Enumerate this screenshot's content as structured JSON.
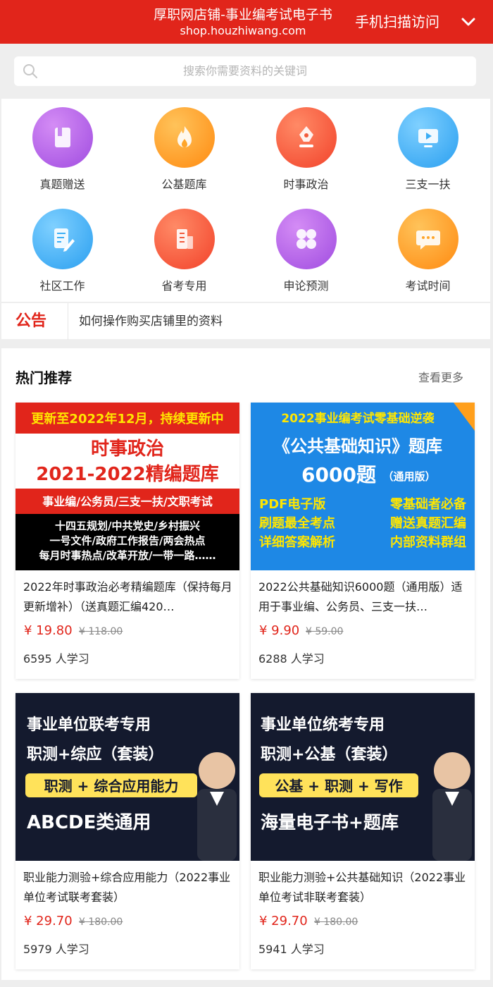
{
  "header": {
    "title": "厚职网店铺-事业编考试电子书",
    "url": "shop.houzhiwang.com",
    "scan_label": "手机扫描访问",
    "chevron_icon": "chevron-down-icon",
    "background": "#e1251b"
  },
  "search": {
    "placeholder": "搜索你需要资料的关键词",
    "icon": "search-icon"
  },
  "categories": [
    {
      "label": "真题赠送",
      "icon": "book-icon",
      "color": "#b15fe6"
    },
    {
      "label": "公基题库",
      "icon": "flame-icon",
      "color": "#ff9f1c"
    },
    {
      "label": "时事政治",
      "icon": "pen-nib-icon",
      "color": "#ff5a3c"
    },
    {
      "label": "三支一扶",
      "icon": "video-icon",
      "color": "#3aaef5"
    },
    {
      "label": "社区工作",
      "icon": "document-edit-icon",
      "color": "#3aaef5"
    },
    {
      "label": "省考专用",
      "icon": "building-icon",
      "color": "#ff5a3c"
    },
    {
      "label": "申论预测",
      "icon": "clover-icon",
      "color": "#b15fe6"
    },
    {
      "label": "考试时间",
      "icon": "chat-bubble-icon",
      "color": "#ff9f1c"
    }
  ],
  "notice": {
    "tag": "公告",
    "text": "如何操作购买店铺里的资料"
  },
  "hot": {
    "title": "热门推荐",
    "more": "查看更多"
  },
  "products": [
    {
      "name": "2022年时事政治必考精编题库（保持每月更新增补）（送真题汇编420…",
      "price": "¥ 19.80",
      "original": "¥ 118.00",
      "learners": "6595 人学习",
      "poster": {
        "top_banner": "更新至2022年12月，持续更新中",
        "line1": "时事政治",
        "line2": "2021-2022精编题库",
        "red_bar": "事业编/公务员/三支一扶/文职考试",
        "l3": "十四五规划/中共党史/乡村振兴",
        "l4": "一号文件/政府工作报告/两会热点",
        "l5": "每月时事热点/改革开放/一带一路……"
      }
    },
    {
      "name": "2022公共基础知识6000题（通用版）适用于事业编、公务员、三支一扶…",
      "price": "¥ 9.90",
      "original": "¥ 59.00",
      "learners": "6288 人学习",
      "poster": {
        "line1": "2022事业编考试零基础逆袭",
        "line2": "《公共基础知识》题库",
        "line3a": "6000题",
        "line3b": "（通用版）",
        "left1": "PDF电子版",
        "left2": "刷题最全考点",
        "left3": "详细答案解析",
        "right1": "零基础者必备",
        "right2": "赠送真题汇编",
        "right3": "内部资料群组"
      }
    },
    {
      "name": "职业能力测验+综合应用能力（2022事业单位考试联考套装）",
      "price": "¥ 29.70",
      "original": "¥ 180.00",
      "learners": "5979 人学习",
      "poster": {
        "line1": "事业单位联考专用",
        "line2": "职测+综应（套装）",
        "yellow": "职测 + 综合应用能力",
        "line4": "ABCDE类通用"
      }
    },
    {
      "name": "职业能力测验+公共基础知识（2022事业单位考试非联考套装）",
      "price": "¥ 29.70",
      "original": "¥ 180.00",
      "learners": "5941 人学习",
      "poster": {
        "line1": "事业单位统考专用",
        "line2": "职测+公基（套装）",
        "yellow": "公基 + 职测 + 写作",
        "line4": "海量电子书+题库"
      }
    }
  ]
}
